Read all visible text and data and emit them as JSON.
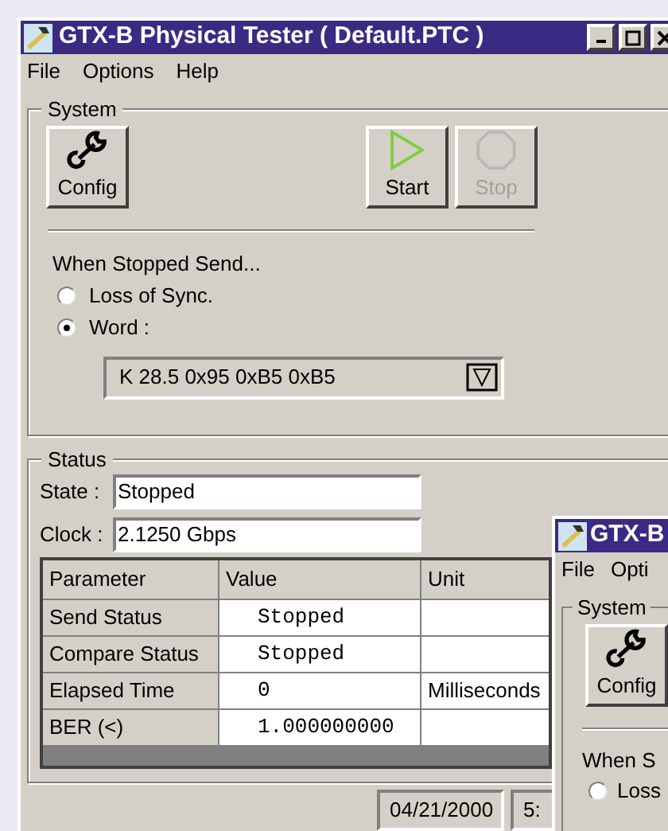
{
  "window": {
    "title": "GTX-B Physical Tester ( Default.PTC )"
  },
  "menu": [
    "File",
    "Options",
    "Help"
  ],
  "system": {
    "title": "System",
    "buttons": [
      {
        "label": "Config",
        "kind": "config",
        "disabled": false
      },
      {
        "label": "Start",
        "kind": "start",
        "disabled": false
      },
      {
        "label": "Stop",
        "kind": "stop",
        "disabled": true
      }
    ],
    "prompt": "When Stopped Send...",
    "options": [
      {
        "label": "Loss of Sync.",
        "selected": false
      },
      {
        "label": "Word :",
        "selected": true
      }
    ],
    "word": {
      "value": "K 28.5 0x95 0xB5 0xB5"
    }
  },
  "status": {
    "title": "Status",
    "fields": [
      {
        "label": "State :",
        "value": "Stopped"
      },
      {
        "label": "Clock :",
        "value": "2.1250 Gbps"
      }
    ],
    "table": {
      "columns": [
        "Parameter",
        "Value",
        "Unit"
      ],
      "rows": [
        {
          "parameter": "Send Status",
          "value": "Stopped"
        },
        {
          "parameter": "Compare Status",
          "value": "Stopped"
        },
        {
          "parameter": "Elapsed Time",
          "value": "0",
          "unit": "Milliseconds"
        },
        {
          "parameter": "BER (<)",
          "value": "1.000000000"
        }
      ]
    }
  },
  "status_bar": [
    "04/21/2000",
    "5:"
  ],
  "second_window": {
    "title": "GTX-B",
    "menu": [
      "File",
      "Opti"
    ],
    "system_title": "System",
    "button": "Config",
    "prompt": "When S",
    "option": {
      "label": "Loss",
      "selected": false
    }
  }
}
